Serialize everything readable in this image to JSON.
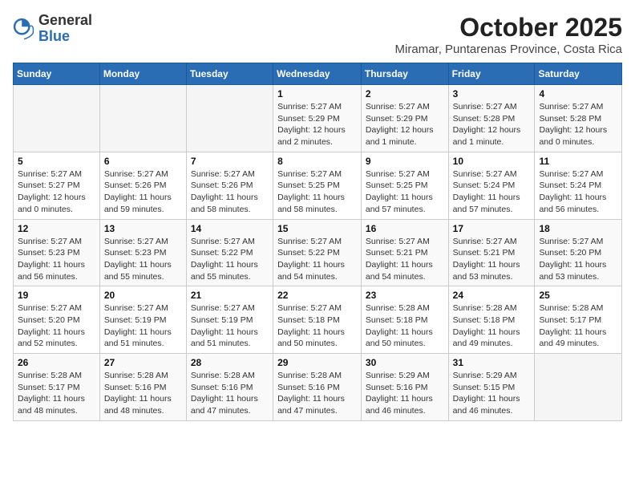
{
  "header": {
    "logo_general": "General",
    "logo_blue": "Blue",
    "month": "October 2025",
    "location": "Miramar, Puntarenas Province, Costa Rica"
  },
  "weekdays": [
    "Sunday",
    "Monday",
    "Tuesday",
    "Wednesday",
    "Thursday",
    "Friday",
    "Saturday"
  ],
  "weeks": [
    [
      {
        "day": "",
        "info": ""
      },
      {
        "day": "",
        "info": ""
      },
      {
        "day": "",
        "info": ""
      },
      {
        "day": "1",
        "info": "Sunrise: 5:27 AM\nSunset: 5:29 PM\nDaylight: 12 hours\nand 2 minutes."
      },
      {
        "day": "2",
        "info": "Sunrise: 5:27 AM\nSunset: 5:29 PM\nDaylight: 12 hours\nand 1 minute."
      },
      {
        "day": "3",
        "info": "Sunrise: 5:27 AM\nSunset: 5:28 PM\nDaylight: 12 hours\nand 1 minute."
      },
      {
        "day": "4",
        "info": "Sunrise: 5:27 AM\nSunset: 5:28 PM\nDaylight: 12 hours\nand 0 minutes."
      }
    ],
    [
      {
        "day": "5",
        "info": "Sunrise: 5:27 AM\nSunset: 5:27 PM\nDaylight: 12 hours\nand 0 minutes."
      },
      {
        "day": "6",
        "info": "Sunrise: 5:27 AM\nSunset: 5:26 PM\nDaylight: 11 hours\nand 59 minutes."
      },
      {
        "day": "7",
        "info": "Sunrise: 5:27 AM\nSunset: 5:26 PM\nDaylight: 11 hours\nand 58 minutes."
      },
      {
        "day": "8",
        "info": "Sunrise: 5:27 AM\nSunset: 5:25 PM\nDaylight: 11 hours\nand 58 minutes."
      },
      {
        "day": "9",
        "info": "Sunrise: 5:27 AM\nSunset: 5:25 PM\nDaylight: 11 hours\nand 57 minutes."
      },
      {
        "day": "10",
        "info": "Sunrise: 5:27 AM\nSunset: 5:24 PM\nDaylight: 11 hours\nand 57 minutes."
      },
      {
        "day": "11",
        "info": "Sunrise: 5:27 AM\nSunset: 5:24 PM\nDaylight: 11 hours\nand 56 minutes."
      }
    ],
    [
      {
        "day": "12",
        "info": "Sunrise: 5:27 AM\nSunset: 5:23 PM\nDaylight: 11 hours\nand 56 minutes."
      },
      {
        "day": "13",
        "info": "Sunrise: 5:27 AM\nSunset: 5:23 PM\nDaylight: 11 hours\nand 55 minutes."
      },
      {
        "day": "14",
        "info": "Sunrise: 5:27 AM\nSunset: 5:22 PM\nDaylight: 11 hours\nand 55 minutes."
      },
      {
        "day": "15",
        "info": "Sunrise: 5:27 AM\nSunset: 5:22 PM\nDaylight: 11 hours\nand 54 minutes."
      },
      {
        "day": "16",
        "info": "Sunrise: 5:27 AM\nSunset: 5:21 PM\nDaylight: 11 hours\nand 54 minutes."
      },
      {
        "day": "17",
        "info": "Sunrise: 5:27 AM\nSunset: 5:21 PM\nDaylight: 11 hours\nand 53 minutes."
      },
      {
        "day": "18",
        "info": "Sunrise: 5:27 AM\nSunset: 5:20 PM\nDaylight: 11 hours\nand 53 minutes."
      }
    ],
    [
      {
        "day": "19",
        "info": "Sunrise: 5:27 AM\nSunset: 5:20 PM\nDaylight: 11 hours\nand 52 minutes."
      },
      {
        "day": "20",
        "info": "Sunrise: 5:27 AM\nSunset: 5:19 PM\nDaylight: 11 hours\nand 51 minutes."
      },
      {
        "day": "21",
        "info": "Sunrise: 5:27 AM\nSunset: 5:19 PM\nDaylight: 11 hours\nand 51 minutes."
      },
      {
        "day": "22",
        "info": "Sunrise: 5:27 AM\nSunset: 5:18 PM\nDaylight: 11 hours\nand 50 minutes."
      },
      {
        "day": "23",
        "info": "Sunrise: 5:28 AM\nSunset: 5:18 PM\nDaylight: 11 hours\nand 50 minutes."
      },
      {
        "day": "24",
        "info": "Sunrise: 5:28 AM\nSunset: 5:18 PM\nDaylight: 11 hours\nand 49 minutes."
      },
      {
        "day": "25",
        "info": "Sunrise: 5:28 AM\nSunset: 5:17 PM\nDaylight: 11 hours\nand 49 minutes."
      }
    ],
    [
      {
        "day": "26",
        "info": "Sunrise: 5:28 AM\nSunset: 5:17 PM\nDaylight: 11 hours\nand 48 minutes."
      },
      {
        "day": "27",
        "info": "Sunrise: 5:28 AM\nSunset: 5:16 PM\nDaylight: 11 hours\nand 48 minutes."
      },
      {
        "day": "28",
        "info": "Sunrise: 5:28 AM\nSunset: 5:16 PM\nDaylight: 11 hours\nand 47 minutes."
      },
      {
        "day": "29",
        "info": "Sunrise: 5:28 AM\nSunset: 5:16 PM\nDaylight: 11 hours\nand 47 minutes."
      },
      {
        "day": "30",
        "info": "Sunrise: 5:29 AM\nSunset: 5:16 PM\nDaylight: 11 hours\nand 46 minutes."
      },
      {
        "day": "31",
        "info": "Sunrise: 5:29 AM\nSunset: 5:15 PM\nDaylight: 11 hours\nand 46 minutes."
      },
      {
        "day": "",
        "info": ""
      }
    ]
  ]
}
